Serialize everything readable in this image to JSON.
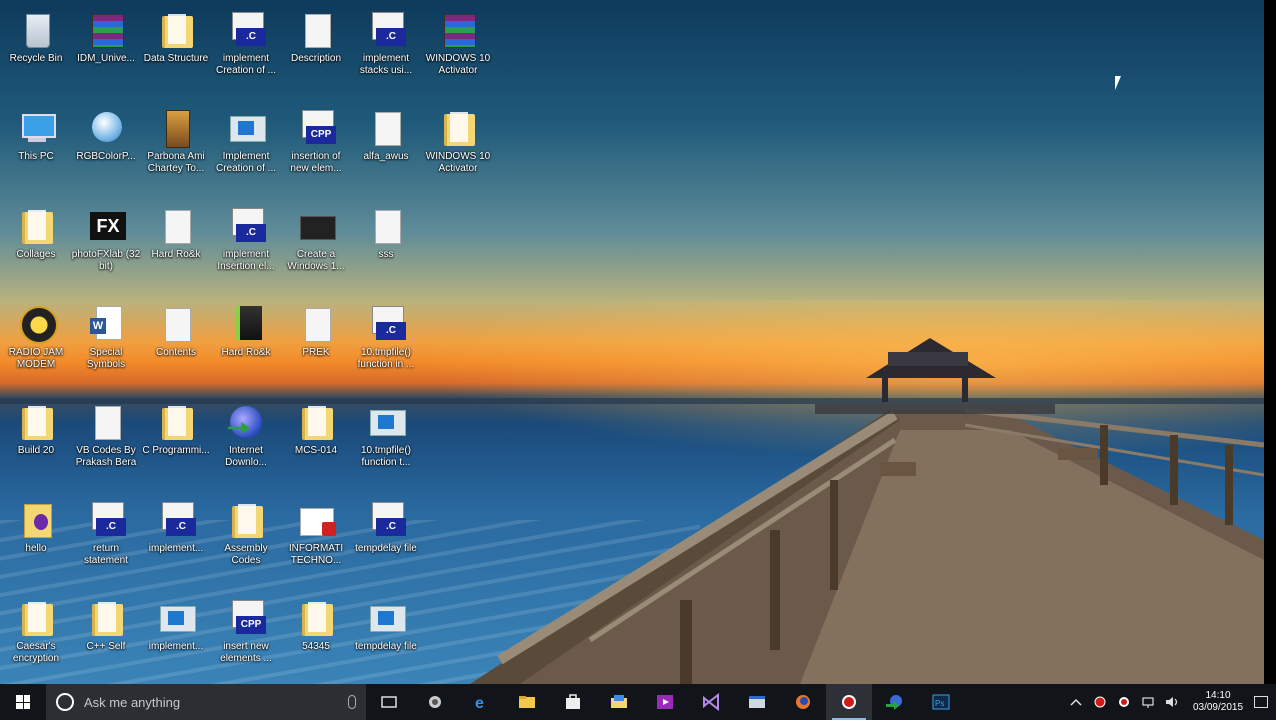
{
  "desktop": {
    "icons": [
      {
        "label": "Recycle Bin"
      },
      {
        "label": "IDM_Unive..."
      },
      {
        "label": "Data Structure"
      },
      {
        "label": "implement Creation of ...",
        "ext": ".C"
      },
      {
        "label": "Description"
      },
      {
        "label": "implement stacks usi...",
        "ext": ".C"
      },
      {
        "label": "WINDOWS 10 Activator"
      },
      {
        "label": "This PC"
      },
      {
        "label": "RGBColorP..."
      },
      {
        "label": "Parbona Ami Chartey To..."
      },
      {
        "label": "Implement Creation of ..."
      },
      {
        "label": "insertion of new elem...",
        "ext": "CPP"
      },
      {
        "label": "alfa_awus"
      },
      {
        "label": "WINDOWS 10 Activator"
      },
      {
        "label": "Collages"
      },
      {
        "label": "photoFXlab (32 bit)"
      },
      {
        "label": "Hard Ro&k"
      },
      {
        "label": "implement Insertion el...",
        "ext": ".C"
      },
      {
        "label": "Create a Windows 1..."
      },
      {
        "label": "sss"
      },
      {
        "label": "RADIO JAM MODEM"
      },
      {
        "label": "Special Symbols"
      },
      {
        "label": "Contents"
      },
      {
        "label": "Hard Ro&k"
      },
      {
        "label": "PREK"
      },
      {
        "label": "10.tmpfile() function in ...",
        "ext": ".C"
      },
      {
        "label": "Build 20"
      },
      {
        "label": "VB Codes By Prakash Bera"
      },
      {
        "label": "C Programmi..."
      },
      {
        "label": "Internet Downlo..."
      },
      {
        "label": "MCS-014"
      },
      {
        "label": "10.tmpfile() function t..."
      },
      {
        "label": "hello"
      },
      {
        "label": "return statement",
        "ext": ".C"
      },
      {
        "label": "implement...",
        "ext": ".C"
      },
      {
        "label": "Assembly Codes"
      },
      {
        "label": "INFORMATI TECHNO..."
      },
      {
        "label": "tempdelay file",
        "ext": ".C"
      },
      {
        "label": "Caesar's encryption"
      },
      {
        "label": "C++ Self"
      },
      {
        "label": "implement..."
      },
      {
        "label": "insert new elements ...",
        "ext": "CPP"
      },
      {
        "label": "54345"
      },
      {
        "label": "tempdelay file"
      }
    ]
  },
  "taskbar": {
    "search_placeholder": "Ask me anything",
    "clock_time": "14:10",
    "clock_date": "03/09/2015"
  },
  "colors": {
    "taskbar_bg": "#111418",
    "search_bg": "#2b2e33",
    "accent": "#8ab8e8"
  }
}
